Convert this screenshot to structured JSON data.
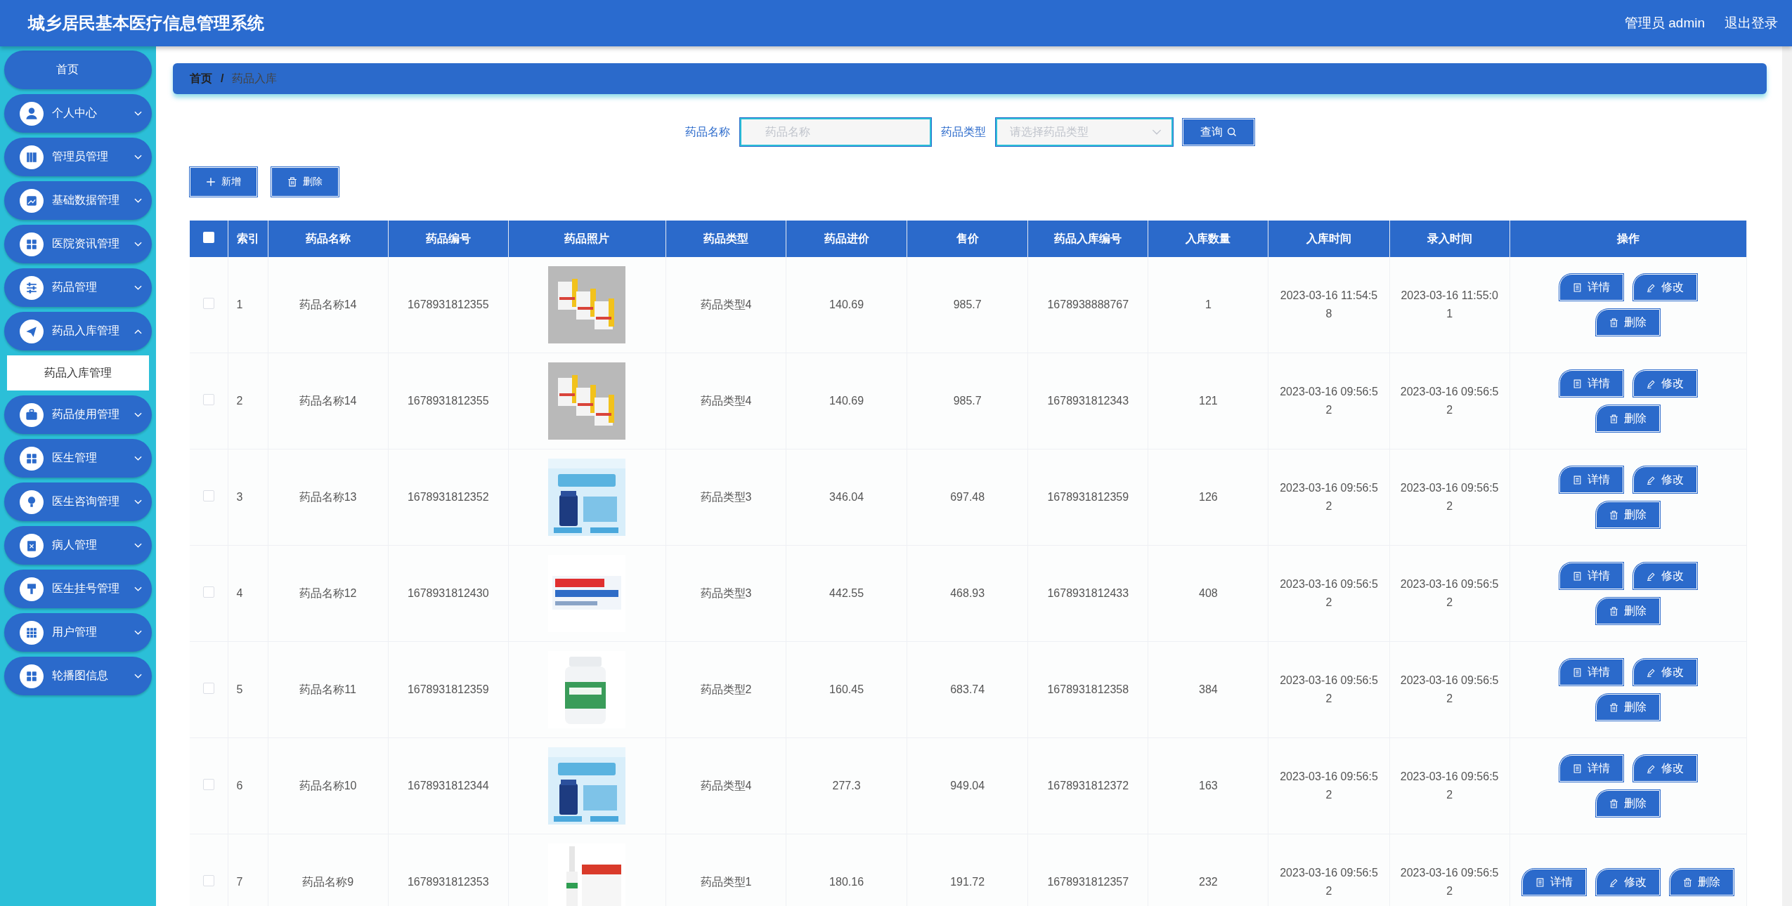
{
  "header": {
    "title": "城乡居民基本医疗信息管理系统",
    "user": "管理员 admin",
    "logout": "退出登录"
  },
  "sidebar": {
    "items": [
      {
        "label": "首页",
        "kind": "home"
      },
      {
        "label": "个人中心",
        "kind": "group",
        "expanded": false
      },
      {
        "label": "管理员管理",
        "kind": "group",
        "expanded": false
      },
      {
        "label": "基础数据管理",
        "kind": "group",
        "expanded": false
      },
      {
        "label": "医院资讯管理",
        "kind": "group",
        "expanded": false
      },
      {
        "label": "药品管理",
        "kind": "group",
        "expanded": false
      },
      {
        "label": "药品入库管理",
        "kind": "group",
        "expanded": true,
        "children": [
          {
            "label": "药品入库管理",
            "selected": true
          }
        ]
      },
      {
        "label": "药品使用管理",
        "kind": "group",
        "expanded": false
      },
      {
        "label": "医生管理",
        "kind": "group",
        "expanded": false
      },
      {
        "label": "医生咨询管理",
        "kind": "group",
        "expanded": false
      },
      {
        "label": "病人管理",
        "kind": "group",
        "expanded": false
      },
      {
        "label": "医生挂号管理",
        "kind": "group",
        "expanded": false
      },
      {
        "label": "用户管理",
        "kind": "group",
        "expanded": false
      },
      {
        "label": "轮播图信息",
        "kind": "group",
        "expanded": false
      }
    ]
  },
  "breadcrumb": {
    "items": [
      "首页",
      "药品入库"
    ],
    "separator": "/"
  },
  "search": {
    "name_label": "药品名称",
    "name_placeholder": "药品名称",
    "type_label": "药品类型",
    "type_placeholder": "请选择药品类型",
    "button": "查询"
  },
  "toolbar": {
    "add": "新增",
    "delete": "删除"
  },
  "table": {
    "select_all_checked": false,
    "columns": [
      "索引",
      "药品名称",
      "药品编号",
      "药品照片",
      "药品类型",
      "药品进价",
      "售价",
      "药品入库编号",
      "入库数量",
      "入库时间",
      "录入时间",
      "操作"
    ],
    "rows": [
      {
        "checked": false,
        "cells": [
          "1",
          "药品名称14",
          "1678931812355",
          null,
          "药品类型4",
          "140.69",
          "985.7",
          "1678938888767",
          "1",
          "2023-03-16 11:54:58",
          "2023-03-16 11:55:01"
        ],
        "photo": {
          "kind": "picture"
        },
        "actions": [
          "详情",
          "修改",
          "删除"
        ]
      },
      {
        "checked": false,
        "cells": [
          "2",
          "药品名称14",
          "1678931812355",
          null,
          "药品类型4",
          "140.69",
          "985.7",
          "1678931812343",
          "121",
          "2023-03-16 09:56:52",
          "2023-03-16 09:56:52"
        ],
        "photo": {
          "kind": "picture"
        },
        "actions": [
          "详情",
          "修改",
          "删除"
        ]
      },
      {
        "checked": false,
        "cells": [
          "3",
          "药品名称13",
          "1678931812352",
          null,
          "药品类型3",
          "346.04",
          "697.48",
          "1678931812359",
          "126",
          "2023-03-16 09:56:52",
          "2023-03-16 09:56:52"
        ],
        "photo": {
          "kind": "picture"
        },
        "actions": [
          "详情",
          "修改",
          "删除"
        ]
      },
      {
        "checked": false,
        "cells": [
          "4",
          "药品名称12",
          "1678931812430",
          null,
          "药品类型3",
          "442.55",
          "468.93",
          "1678931812433",
          "408",
          "2023-03-16 09:56:52",
          "2023-03-16 09:56:52"
        ],
        "photo": {
          "kind": "picture"
        },
        "actions": [
          "详情",
          "修改",
          "删除"
        ]
      },
      {
        "checked": false,
        "cells": [
          "5",
          "药品名称11",
          "1678931812359",
          null,
          "药品类型2",
          "160.45",
          "683.74",
          "1678931812358",
          "384",
          "2023-03-16 09:56:52",
          "2023-03-16 09:56:52"
        ],
        "photo": {
          "kind": "picture"
        },
        "actions": [
          "详情",
          "修改",
          "删除"
        ]
      },
      {
        "checked": false,
        "cells": [
          "6",
          "药品名称10",
          "1678931812344",
          null,
          "药品类型4",
          "277.3",
          "949.04",
          "1678931812372",
          "163",
          "2023-03-16 09:56:52",
          "2023-03-16 09:56:52"
        ],
        "photo": {
          "kind": "picture"
        },
        "actions": [
          "详情",
          "修改",
          "删除"
        ]
      },
      {
        "checked": false,
        "cells": [
          "7",
          "药品名称9",
          "1678931812353",
          null,
          "药品类型1",
          "180.16",
          "191.72",
          "1678931812357",
          "232",
          "2023-03-16 09:56:52",
          "2023-03-16 09:56:52"
        ],
        "photo": {
          "kind": "picture"
        },
        "actions": [
          "详情",
          "修改",
          "删除"
        ]
      }
    ]
  }
}
